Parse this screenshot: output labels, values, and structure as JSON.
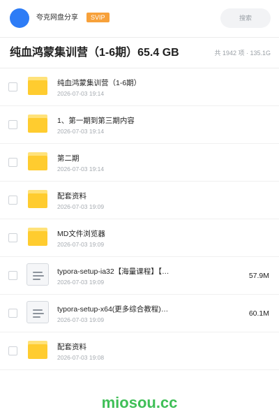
{
  "header": {
    "share_title": "夸克网盘分享",
    "badge": "SVIP",
    "search_label": "搜索"
  },
  "folder": {
    "title": "纯血鸿蒙集训营（1-6期）65.4 GB",
    "stats": "共 1942 项 · 135.1G"
  },
  "files": [
    {
      "name": "纯血鸿蒙集训营（1-6期）",
      "date": "2026-07-03 19:14",
      "size": "",
      "icon": "folder-icon"
    },
    {
      "name": "1、第一期到第三期内容",
      "date": "2026-07-03 19:14",
      "size": "",
      "icon": "folder-icon"
    },
    {
      "name": "第二期",
      "date": "2026-07-03 19:14",
      "size": "",
      "icon": "folder-icon"
    },
    {
      "name": "配套资料",
      "date": "2026-07-03 19:09",
      "size": "",
      "icon": "folder-icon"
    },
    {
      "name": "MD文件浏览器",
      "date": "2026-07-03 19:09",
      "size": "",
      "icon": "folder-icon"
    },
    {
      "name": "typora-setup-ia32【海量课程】【…",
      "date": "2026-07-03 19:09",
      "size": "57.9M",
      "icon": "document-icon"
    },
    {
      "name": "typora-setup-x64(更多综合教程)…",
      "date": "2026-07-03 19:09",
      "size": "60.1M",
      "icon": "document-icon"
    },
    {
      "name": "配套资料",
      "date": "2026-07-03 19:08",
      "size": "",
      "icon": "folder-icon"
    }
  ],
  "watermark": "miosou.cc",
  "colors": {
    "avatar": "#2d7cf6",
    "svip_badge": "#f7a13a",
    "folder": "#ffcc2f",
    "watermark": "#3fbf57"
  }
}
